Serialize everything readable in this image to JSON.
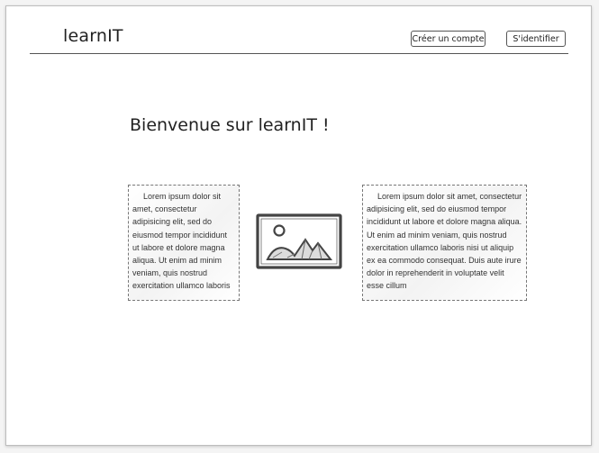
{
  "header": {
    "logo": "learnIT",
    "signup_label": "Créer un compte",
    "login_label": "S'identifier"
  },
  "main": {
    "title": "Bienvenue sur learnIT !",
    "left_text": "Lorem ipsum dolor sit amet, consectetur adipisicing elit, sed do eiusmod tempor incididunt ut labore et dolore magna aliqua. Ut enim ad minim veniam, quis nostrud exercitation ullamco laboris",
    "image_icon": "image-placeholder-icon",
    "right_text": "Lorem ipsum dolor sit amet, consectetur adipisicing elit, sed do eiusmod tempor incididunt ut labore et dolore magna aliqua. Ut enim ad minim veniam, quis nostrud exercitation ullamco laboris nisi ut aliquip ex ea commodo consequat. Duis aute irure dolor in reprehenderit in voluptate velit esse cillum"
  }
}
